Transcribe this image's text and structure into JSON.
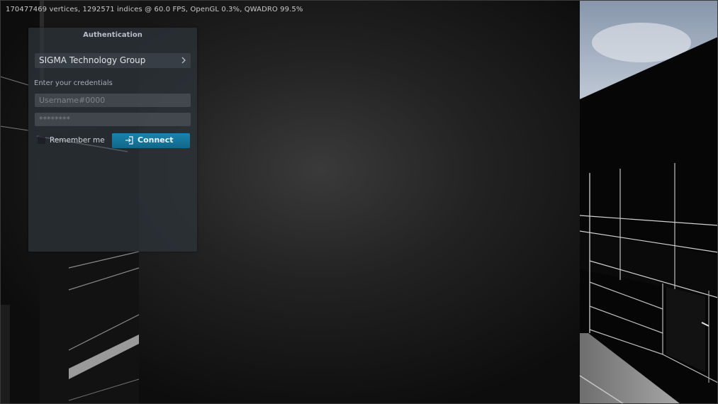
{
  "stats": {
    "text": "170477469 vertices, 1292571 indices @ 60.0 FPS, OpenGL 0.3%, QWADRO 99.5%"
  },
  "auth": {
    "title": "Authentication",
    "server": {
      "label": "SIGMA Technology Group",
      "icon": "chevron-right-icon"
    },
    "instructions": "Enter your credentials",
    "username": {
      "value": "",
      "placeholder": "Username#0000"
    },
    "password": {
      "value": "",
      "placeholder": "********"
    },
    "remember": {
      "label": "Remember me",
      "checked": false
    },
    "connect": {
      "label": "Connect",
      "icon": "login-icon",
      "color": "#1a7ba3"
    }
  },
  "colors": {
    "accent": "#1a7ba3",
    "panel": "#2e343c",
    "scene_dark": "#111111",
    "sky": "#a7b4c6"
  }
}
